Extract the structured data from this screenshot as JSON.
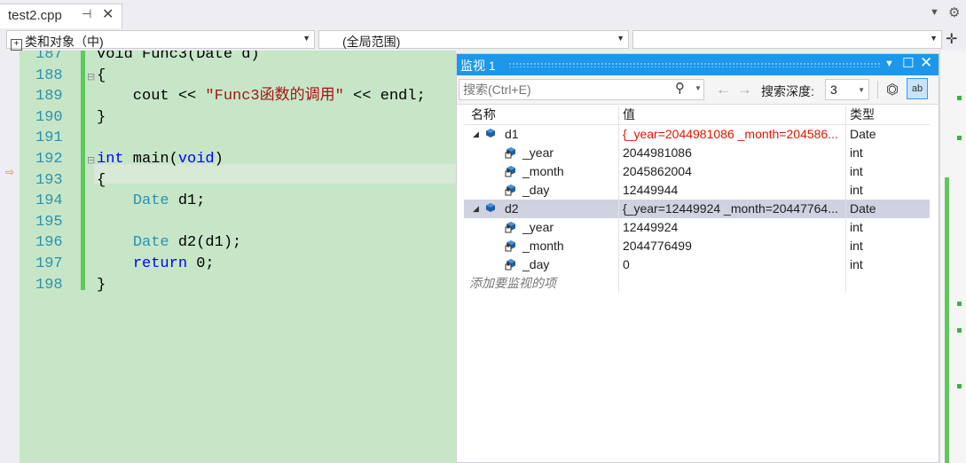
{
  "tab": {
    "title": "test2.cpp",
    "pin": "⊣",
    "close": "✕"
  },
  "nav": {
    "scope_project": "类和对象（中)",
    "scope_global": "(全局范围)",
    "scope_member": ""
  },
  "editor": {
    "lines": [
      {
        "num": "187",
        "segments": [
          {
            "t": "void Func3(Date d)",
            "c": "partial"
          }
        ]
      },
      {
        "num": "188",
        "segments": [
          {
            "t": "{",
            "c": "plain"
          }
        ]
      },
      {
        "num": "189",
        "segments": [
          {
            "t": "    cout << ",
            "c": "plain"
          },
          {
            "t": "\"Func3函数的调用\"",
            "c": "str"
          },
          {
            "t": " << endl;",
            "c": "plain"
          }
        ]
      },
      {
        "num": "190",
        "segments": [
          {
            "t": "}",
            "c": "plain"
          }
        ]
      },
      {
        "num": "191",
        "segments": []
      },
      {
        "num": "192",
        "segments": [
          {
            "t": "int",
            "c": "kw"
          },
          {
            "t": " main(",
            "c": "plain"
          },
          {
            "t": "void",
            "c": "kw"
          },
          {
            "t": ")",
            "c": "plain"
          }
        ]
      },
      {
        "num": "193",
        "segments": [
          {
            "t": "{",
            "c": "plain"
          }
        ]
      },
      {
        "num": "194",
        "segments": [
          {
            "t": "    ",
            "c": "plain"
          },
          {
            "t": "Date",
            "c": "ty"
          },
          {
            "t": " d1;",
            "c": "plain"
          }
        ]
      },
      {
        "num": "195",
        "segments": []
      },
      {
        "num": "196",
        "segments": [
          {
            "t": "    ",
            "c": "plain"
          },
          {
            "t": "Date",
            "c": "ty"
          },
          {
            "t": " d2(d1);",
            "c": "plain"
          }
        ]
      },
      {
        "num": "197",
        "segments": [
          {
            "t": "    ",
            "c": "plain"
          },
          {
            "t": "return",
            "c": "kw"
          },
          {
            "t": " 0;",
            "c": "plain"
          }
        ]
      },
      {
        "num": "198",
        "segments": [
          {
            "t": "}",
            "c": "plain"
          }
        ]
      }
    ]
  },
  "watch": {
    "title": "监视 1",
    "search_placeholder": "搜索(Ctrl+E)",
    "depth_label": "搜索深度:",
    "depth_value": "3",
    "columns": {
      "name": "名称",
      "value": "值",
      "type": "类型"
    },
    "rows": [
      {
        "kind": "obj",
        "name": "d1",
        "value": "{_year=2044981086 _month=204586...",
        "type": "Date",
        "red": true,
        "selected": false
      },
      {
        "kind": "fld",
        "name": "_year",
        "value": "2044981086",
        "type": "int"
      },
      {
        "kind": "fld",
        "name": "_month",
        "value": "2045862004",
        "type": "int"
      },
      {
        "kind": "fld",
        "name": "_day",
        "value": "12449944",
        "type": "int"
      },
      {
        "kind": "obj",
        "name": "d2",
        "value": "{_year=12449924 _month=20447764...",
        "type": "Date",
        "red": false,
        "selected": true
      },
      {
        "kind": "fld",
        "name": "_year",
        "value": "12449924",
        "type": "int"
      },
      {
        "kind": "fld",
        "name": "_month",
        "value": "2044776499",
        "type": "int"
      },
      {
        "kind": "fld",
        "name": "_day",
        "value": "0",
        "type": "int"
      }
    ],
    "add_item_placeholder": "添加要监视的项"
  },
  "colors": {
    "accent": "#1c97ea",
    "code_bg": "#c7e6c8",
    "change_bar": "#5ec85e",
    "error_red": "#e51400"
  }
}
